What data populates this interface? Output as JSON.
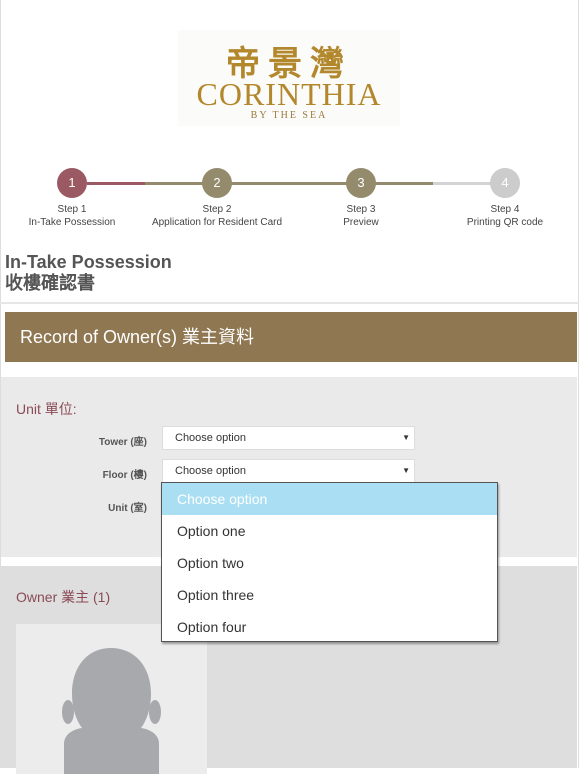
{
  "logo": {
    "chinese": "帝景灣",
    "english": "CORINTHIA",
    "tagline": "BY THE SEA",
    "color": "#b3882d"
  },
  "stepper": {
    "steps": [
      {
        "number": "1",
        "title": "Step 1",
        "subtitle": "In-Take Possession",
        "color": "#9b5a63"
      },
      {
        "number": "2",
        "title": "Step 2",
        "subtitle": "Application for Resident Card",
        "color": "#948b6c"
      },
      {
        "number": "3",
        "title": "Step 3",
        "subtitle": "Preview",
        "color": "#948b6c"
      },
      {
        "number": "4",
        "title": "Step 4",
        "subtitle": "Printing QR code",
        "color": "#cccccc"
      }
    ]
  },
  "page": {
    "title": "In-Take Possession",
    "subtitle": "收樓確認書"
  },
  "section": {
    "header": "Record of Owner(s) 業主資料",
    "color": "#8f7751"
  },
  "unit": {
    "legend": "Unit 單位:",
    "tower_label": "Tower (座)",
    "floor_label": "Floor (樓)",
    "unit_label": "Unit (室)",
    "tower_value": "Choose option",
    "floor_value": "Choose option"
  },
  "owner": {
    "legend": "Owner 業主 (1)"
  },
  "dropdown": {
    "options": [
      "Choose option",
      "Option one",
      "Option two",
      "Option three",
      "Option four"
    ],
    "highlight_color": "#aadff3"
  }
}
